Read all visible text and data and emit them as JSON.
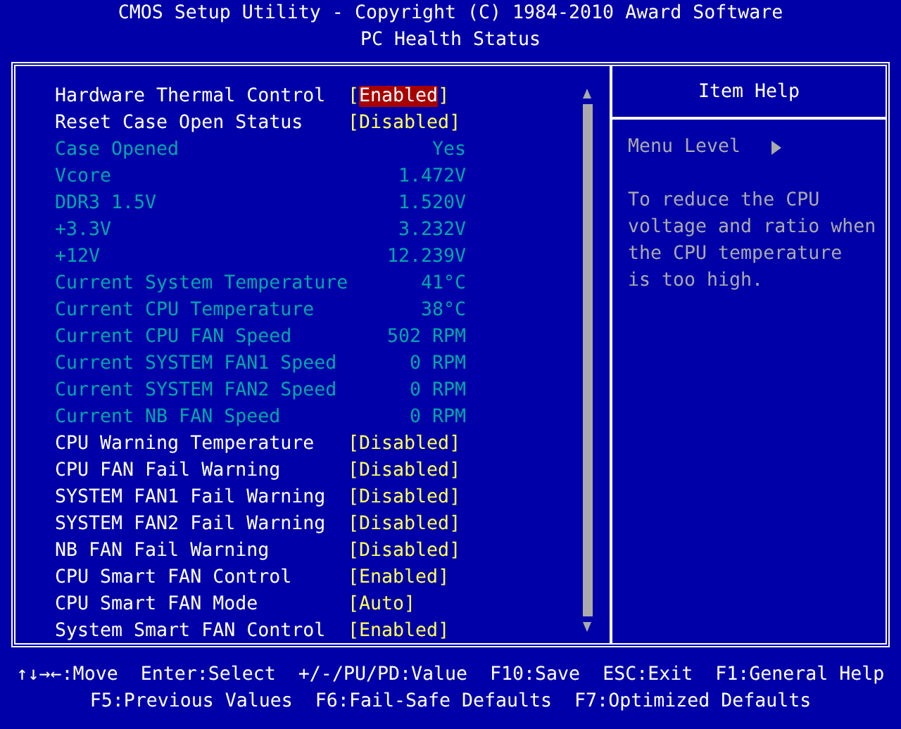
{
  "header": {
    "title": "CMOS Setup Utility - Copyright (C) 1984-2010 Award Software",
    "subtitle": "PC Health Status"
  },
  "items": [
    {
      "kind": "setting",
      "label": "Hardware Thermal Control",
      "value": "[Enabled]",
      "selected": true
    },
    {
      "kind": "setting",
      "label": "Reset Case Open Status",
      "value": "[Disabled]",
      "selected": false
    },
    {
      "kind": "info",
      "label": "Case Opened",
      "value": "Yes",
      "selected": false
    },
    {
      "kind": "info",
      "label": "Vcore",
      "value": "1.472V",
      "selected": false
    },
    {
      "kind": "info",
      "label": "DDR3 1.5V",
      "value": "1.520V",
      "selected": false
    },
    {
      "kind": "info",
      "label": "+3.3V",
      "value": "3.232V",
      "selected": false
    },
    {
      "kind": "info",
      "label": "+12V",
      "value": "12.239V",
      "selected": false
    },
    {
      "kind": "info",
      "label": "Current System Temperature",
      "value": "41°C",
      "selected": false
    },
    {
      "kind": "info",
      "label": "Current CPU Temperature",
      "value": "38°C",
      "selected": false
    },
    {
      "kind": "info",
      "label": "Current CPU FAN Speed",
      "value": "502 RPM",
      "selected": false
    },
    {
      "kind": "info",
      "label": "Current SYSTEM FAN1 Speed",
      "value": "0 RPM",
      "selected": false
    },
    {
      "kind": "info",
      "label": "Current SYSTEM FAN2 Speed",
      "value": "0 RPM",
      "selected": false
    },
    {
      "kind": "info",
      "label": "Current NB FAN Speed",
      "value": "0 RPM",
      "selected": false
    },
    {
      "kind": "setting",
      "label": "CPU Warning Temperature",
      "value": "[Disabled]",
      "selected": false
    },
    {
      "kind": "setting",
      "label": "CPU FAN Fail Warning",
      "value": "[Disabled]",
      "selected": false
    },
    {
      "kind": "setting",
      "label": "SYSTEM FAN1 Fail Warning",
      "value": "[Disabled]",
      "selected": false
    },
    {
      "kind": "setting",
      "label": "SYSTEM FAN2 Fail Warning",
      "value": "[Disabled]",
      "selected": false
    },
    {
      "kind": "setting",
      "label": "NB FAN Fail Warning",
      "value": "[Disabled]",
      "selected": false
    },
    {
      "kind": "setting",
      "label": "CPU Smart FAN Control",
      "value": "[Enabled]",
      "selected": false
    },
    {
      "kind": "setting",
      "label": "CPU Smart FAN Mode",
      "value": "[Auto]",
      "selected": false
    },
    {
      "kind": "setting",
      "label": "System Smart FAN Control",
      "value": "[Enabled]",
      "selected": false
    }
  ],
  "help": {
    "title": "Item Help",
    "menu_level": "Menu Level",
    "lines": [
      "To reduce the CPU",
      "voltage and ratio when",
      "the CPU temperature",
      "is too high."
    ]
  },
  "footer": [
    [
      "↑↓→←:Move",
      "Enter:Select",
      "+/-/PU/PD:Value",
      "F10:Save",
      "ESC:Exit",
      "F1:General Help"
    ],
    [
      "F5:Previous Values",
      "F6:Fail-Safe Defaults",
      "F7:Optimized Defaults"
    ]
  ]
}
